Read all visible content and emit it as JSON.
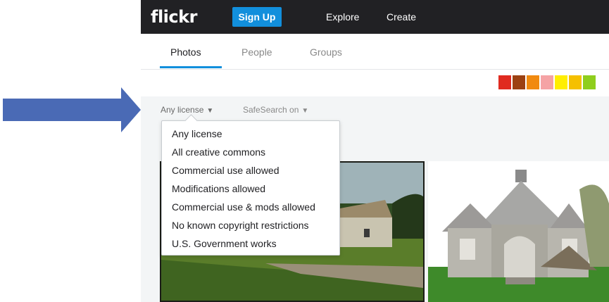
{
  "header": {
    "logo": "flickr",
    "signup_label": "Sign Up",
    "nav": [
      "Explore",
      "Create"
    ]
  },
  "tabs": [
    "Photos",
    "People",
    "Groups"
  ],
  "active_tab": "Photos",
  "color_swatches": [
    "#e02b20",
    "#9c4112",
    "#f18a0f",
    "#f5a3a5",
    "#ffee00",
    "#f5c000",
    "#8fce1d"
  ],
  "filters": {
    "license_label": "Any license",
    "safesearch_label": "SafeSearch on"
  },
  "license_menu": [
    "Any license",
    "All creative commons",
    "Commercial use allowed",
    "Modifications allowed",
    "Commercial use & mods allowed",
    "No known copyright restrictions",
    "U.S. Government works"
  ],
  "colors": {
    "accent": "#128fdc",
    "topbar": "#212124",
    "annotation_arrow": "#4a6ab5"
  }
}
